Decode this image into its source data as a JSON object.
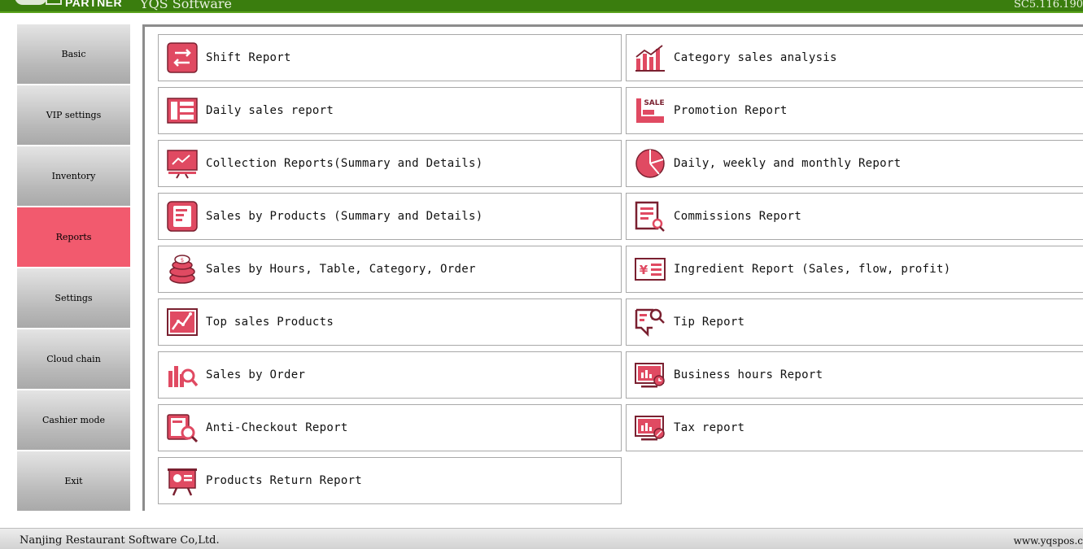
{
  "titlebar": {
    "brand": "PARTNER",
    "app_name": "YQS Software",
    "version": "SC5.116.190"
  },
  "sidebar": {
    "items": [
      {
        "label": "Basic"
      },
      {
        "label": "VIP settings"
      },
      {
        "label": "Inventory"
      },
      {
        "label": "Reports",
        "active": true
      },
      {
        "label": "Settings"
      },
      {
        "label": "Cloud chain"
      },
      {
        "label": "Cashier mode"
      },
      {
        "label": "Exit"
      }
    ]
  },
  "reports": {
    "left": [
      {
        "label": "Shift Report",
        "icon": "shift-report-icon"
      },
      {
        "label": "Daily sales report",
        "icon": "daily-sales-icon"
      },
      {
        "label": "Collection Reports(Summary and Details)",
        "icon": "collection-report-icon"
      },
      {
        "label": "Sales by Products (Summary and Details)",
        "icon": "sales-by-products-icon"
      },
      {
        "label": "Sales by Hours, Table, Category, Order",
        "icon": "coins-icon"
      },
      {
        "label": "Top sales Products",
        "icon": "trend-chart-icon"
      },
      {
        "label": "Sales by Order",
        "icon": "bar-search-icon"
      },
      {
        "label": "Anti-Checkout Report",
        "icon": "anti-checkout-icon"
      },
      {
        "label": "Products Return Report",
        "icon": "presentation-icon"
      }
    ],
    "right": [
      {
        "label": "Category sales analysis",
        "icon": "category-bars-icon"
      },
      {
        "label": "Promotion Report",
        "icon": "sale-tag-icon"
      },
      {
        "label": "Daily, weekly and monthly Report",
        "icon": "pie-chart-icon"
      },
      {
        "label": "Commissions Report",
        "icon": "doc-search-icon"
      },
      {
        "label": "Ingredient Report (Sales, flow, profit)",
        "icon": "yen-list-icon"
      },
      {
        "label": "Tip Report",
        "icon": "tip-search-icon"
      },
      {
        "label": "Business hours Report",
        "icon": "monitor-clock-icon"
      },
      {
        "label": "Tax report",
        "icon": "monitor-tax-icon"
      }
    ]
  },
  "footer": {
    "company": "Nanjing Restaurant Software Co,Ltd.",
    "website": "www.yqspos.c"
  },
  "colors": {
    "titlebar": "#3a7d0e",
    "accent": "#f25a6e",
    "icon": "#e04a62"
  }
}
